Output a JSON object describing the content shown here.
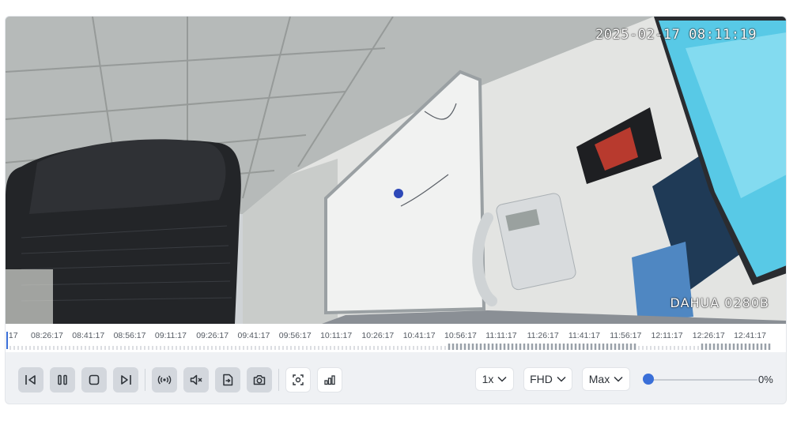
{
  "video": {
    "timestamp": "2025-02-17 08:11:19",
    "camera_name": "DAHUA 0280B"
  },
  "timeline": {
    "labels": [
      ":17",
      "08:26:17",
      "08:41:17",
      "08:56:17",
      "09:11:17",
      "09:26:17",
      "09:41:17",
      "09:56:17",
      "10:11:17",
      "10:26:17",
      "10:41:17",
      "10:56:17",
      "11:11:17",
      "11:26:17",
      "11:41:17",
      "11:56:17",
      "12:11:17",
      "12:26:17",
      "12:41:17"
    ]
  },
  "controls": {
    "buttons": [
      "skip-previous-icon",
      "pause-icon",
      "stop-icon",
      "skip-next-icon",
      "broadcast-icon",
      "mute-icon",
      "export-icon",
      "camera-icon",
      "focus-icon",
      "signal-icon"
    ],
    "speed": "1x",
    "quality": "FHD",
    "size": "Max",
    "volume_percent": "0%",
    "volume_level": 0,
    "accent_color": "#3a6fd8"
  }
}
